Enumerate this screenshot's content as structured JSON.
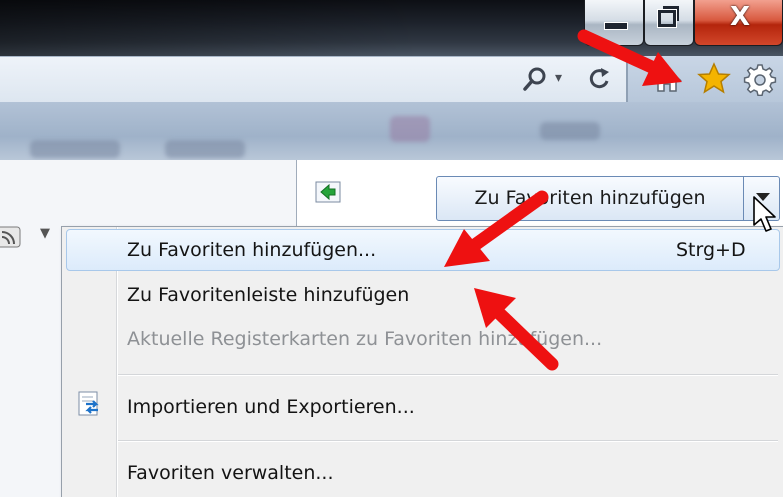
{
  "window_controls": {
    "minimize_symbol": "▬",
    "maximize_symbol": "□",
    "close_symbol": "X"
  },
  "toolbar": {
    "icons": [
      "search-icon",
      "refresh-icon",
      "home-icon",
      "star-icon",
      "gear-icon"
    ]
  },
  "favorites_panel": {
    "add_button_label": "Zu Favoriten hinzufügen",
    "dropdown_caret": "▼"
  },
  "menu": {
    "items": [
      {
        "label": "Zu Favoriten hinzufügen...",
        "shortcut": "Strg+D",
        "enabled": true,
        "highlighted": true
      },
      {
        "label": "Zu Favoritenleiste hinzufügen",
        "enabled": true
      },
      {
        "label": "Aktuelle Registerkarten zu Favoriten hinzufügen...",
        "enabled": false
      },
      {
        "label": "Importieren und Exportieren...",
        "enabled": true,
        "icon": "import-export-icon"
      },
      {
        "label": "Favoriten verwalten...",
        "enabled": true
      }
    ]
  },
  "colors": {
    "annotation_arrow": "#ee1111",
    "highlight": "#dcebfb",
    "star": "#f4b400"
  }
}
